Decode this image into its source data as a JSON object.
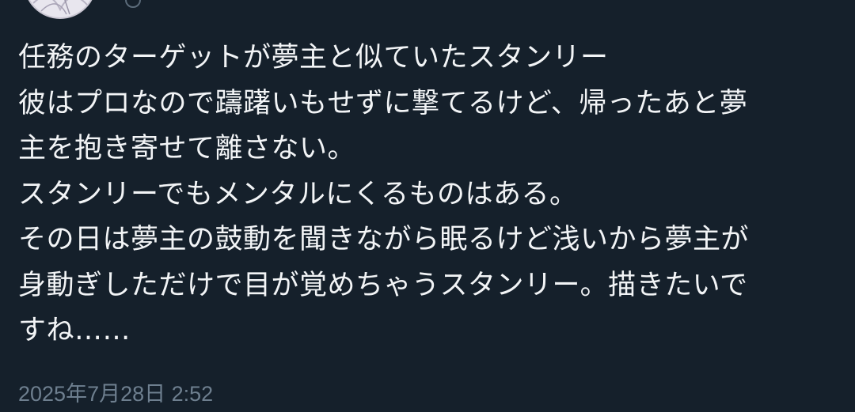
{
  "tweet": {
    "lines": [
      "任務のターゲットが夢主と似ていたスタンリー",
      "彼はプロなので躊躇いもせずに撃てるけど、帰ったあと夢",
      "主を抱き寄せて離さない。",
      "スタンリーでもメンタルにくるものはある。",
      "その日は夢主の鼓動を聞きながら眠るけど浅いから夢主が",
      "身動ぎしただけで目が覚めちゃうスタンリー。描きたいで",
      "すね……"
    ],
    "timestamp": "2025年7月28日 2:52"
  },
  "author": {
    "avatar_icon": "profile-avatar-icon",
    "handle_icon": "at-sign-icon"
  },
  "colors": {
    "background": "#15202b",
    "text": "#f2f4f6",
    "meta": "#6e7f8f"
  }
}
